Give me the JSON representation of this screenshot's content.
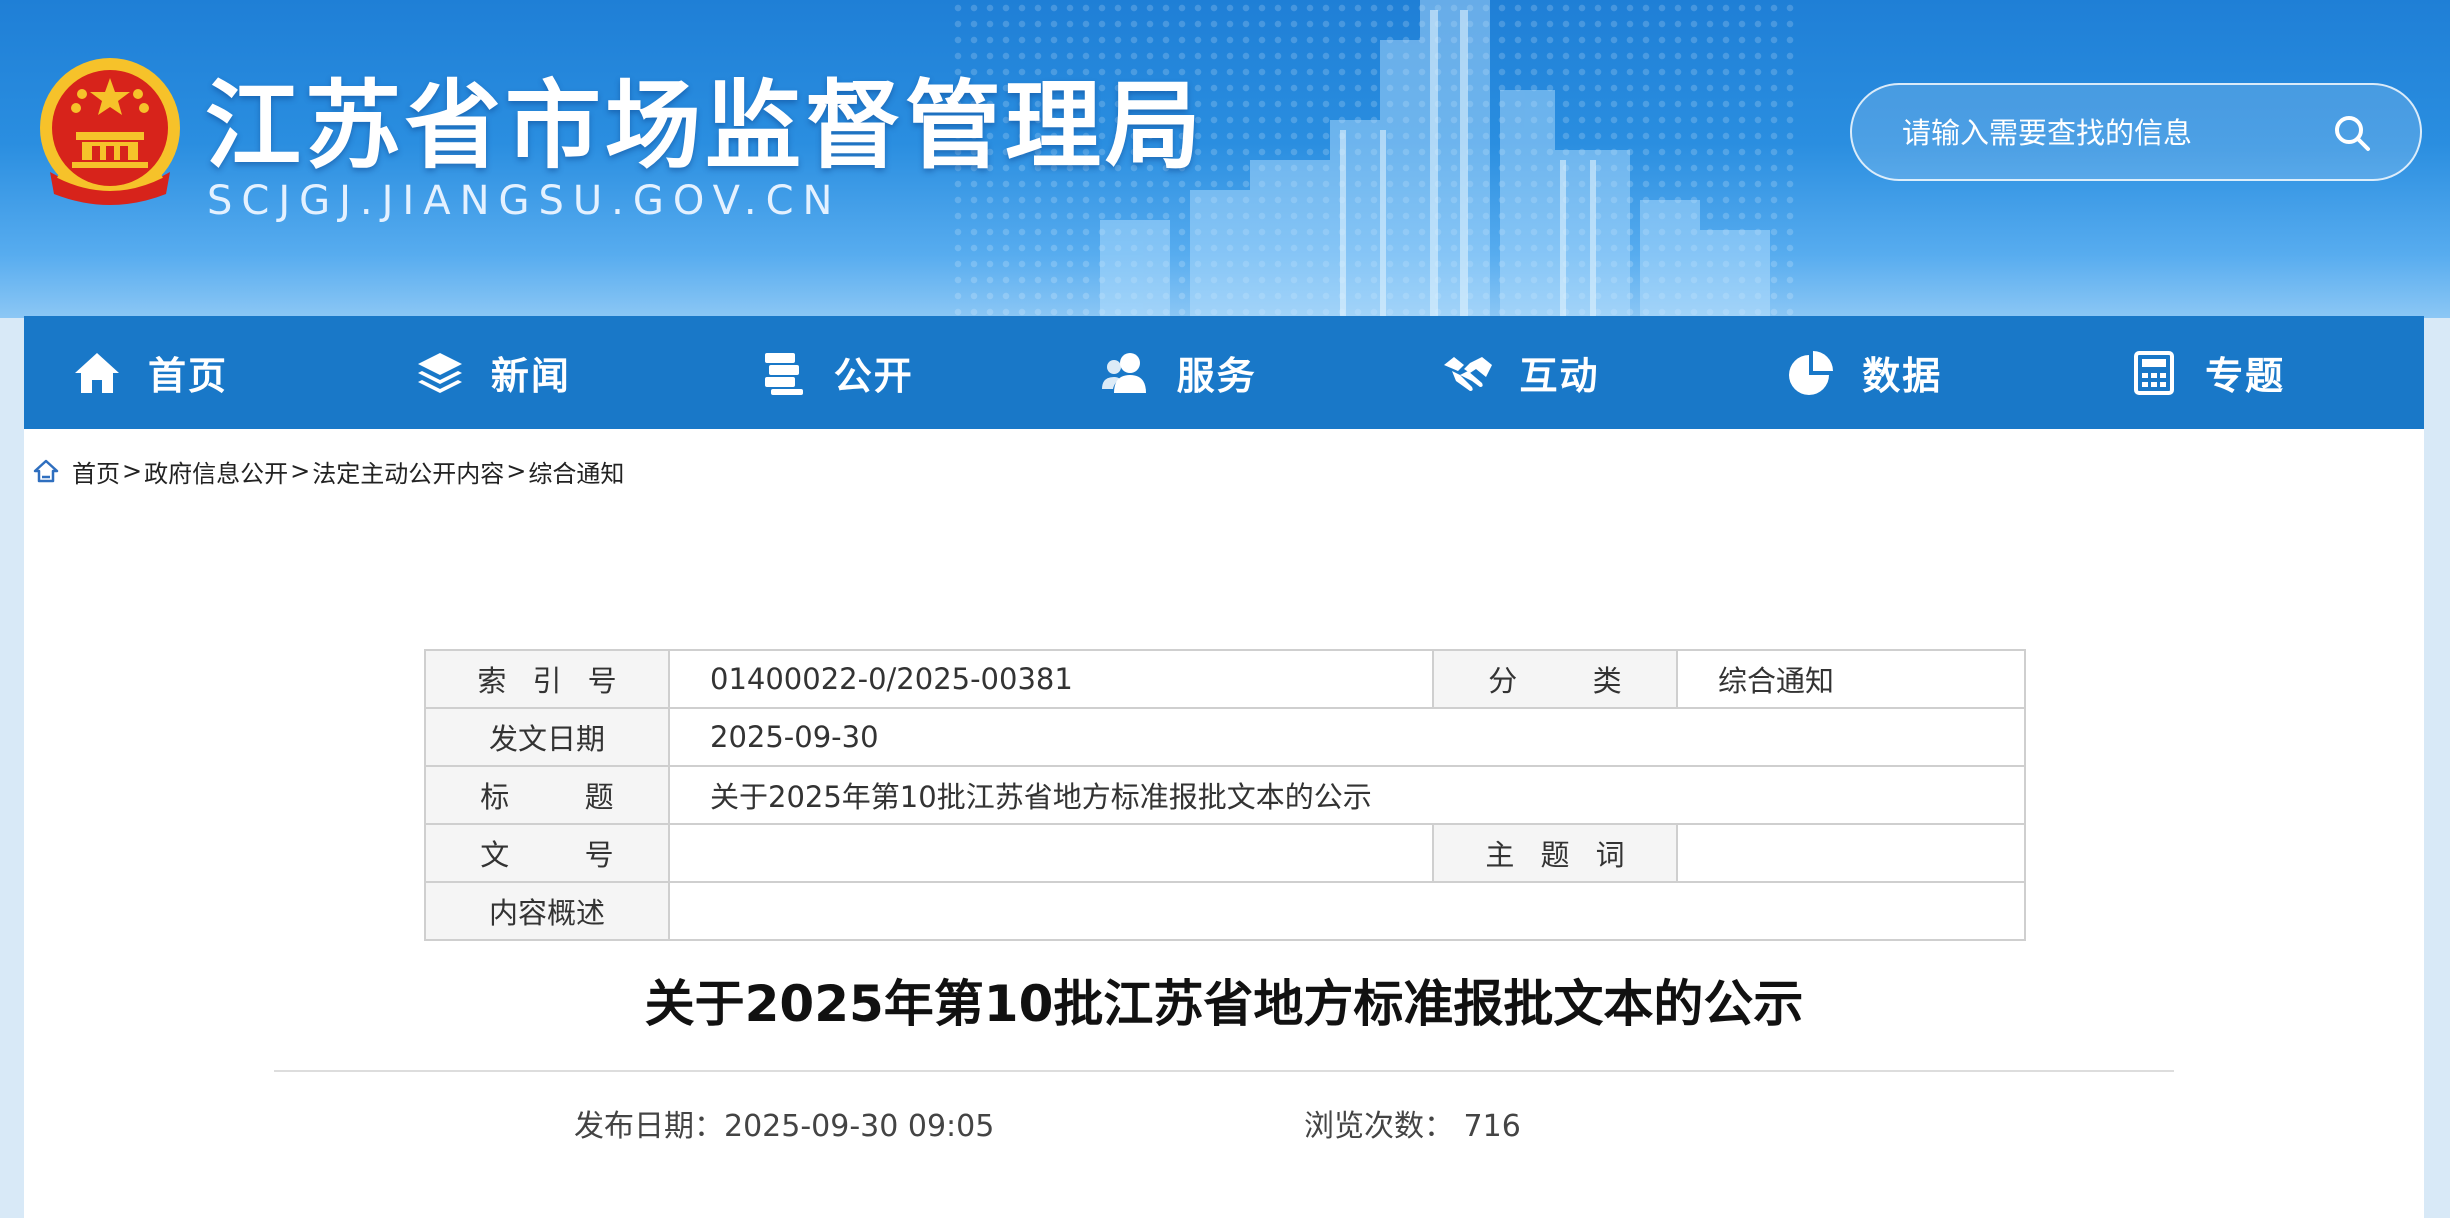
{
  "header": {
    "site_title": "江苏省市场监督管理局",
    "site_domain": "SCJGJ.JIANGSU.GOV.CN",
    "emblem_icon": "national-emblem-icon",
    "search": {
      "placeholder": "请输入需要查找的信息",
      "icon": "search-icon"
    }
  },
  "nav": {
    "items": [
      {
        "label": "首页",
        "icon": "home-icon"
      },
      {
        "label": "新闻",
        "icon": "layers-icon"
      },
      {
        "label": "公开",
        "icon": "documents-icon"
      },
      {
        "label": "服务",
        "icon": "users-icon"
      },
      {
        "label": "互动",
        "icon": "handshake-icon"
      },
      {
        "label": "数据",
        "icon": "pie-chart-icon"
      },
      {
        "label": "专题",
        "icon": "calculator-icon"
      }
    ]
  },
  "breadcrumb": {
    "icon": "home-outline-icon",
    "separator": ">",
    "items": [
      "首页",
      "政府信息公开",
      "法定主动公开内容",
      "综合通知"
    ]
  },
  "meta_table": {
    "index_label": "索引号",
    "index_value": "01400022-0/2025-00381",
    "category_label": "分类",
    "category_value": "综合通知",
    "date_label": "发文日期",
    "date_value": "2025-09-30",
    "title_label": "标题",
    "title_value": "关于2025年第10批江苏省地方标准报批文本的公示",
    "docno_label": "文号",
    "docno_value": "",
    "keywords_label": "主题词",
    "keywords_value": "",
    "summary_label": "内容概述",
    "summary_value": ""
  },
  "article": {
    "title": "关于2025年第10批江苏省地方标准报批文本的公示",
    "publish_label": "发布日期：",
    "publish_value": "2025-09-30 09:05",
    "views_label": "浏览次数：",
    "views_value": "716"
  },
  "colors": {
    "header_blue": "#1f7fd6",
    "nav_blue": "#1978c8",
    "emblem_red": "#d7231b",
    "emblem_gold": "#f6c22a"
  }
}
